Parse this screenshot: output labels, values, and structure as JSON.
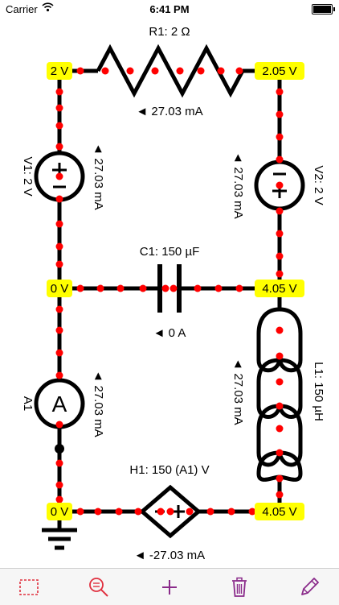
{
  "status_bar": {
    "carrier": "Carrier",
    "time": "6:41 PM"
  },
  "components": {
    "r1": "R1: 2 Ω",
    "v1": "V1: 2 V",
    "v2": "V2: 2 V",
    "c1": "C1: 150 µF",
    "a1": "A1",
    "l1": "L1: 150 µH",
    "h1": "H1: 150 (A1) V"
  },
  "nodes": {
    "top_left": "2 V",
    "top_right": "2.05 V",
    "mid_left": "0 V",
    "mid_right": "4.05 V",
    "bottom_left": "0 V",
    "bottom_right": "4.05 V"
  },
  "currents": {
    "r1": "◄ 27.03 mA",
    "v1": "◄ 27.03 mA",
    "v2": "◄ 27.03 mA",
    "c1": "◄ 0 A",
    "a1": "◄ 27.03 mA",
    "l1": "◄ 27.03 mA",
    "h1": "◄ -27.03 mA"
  },
  "ammeter_symbol": "A",
  "colors": {
    "wire": "#000000",
    "current_dot": "#ff0000",
    "node_label_bg": "#ffff00",
    "toolbar_icon": "#8a2a8a",
    "tool_select": "#e0303f"
  },
  "toolbar": {
    "select_icon": "select-rectangle-icon",
    "zoom_icon": "zoom-icon",
    "add_icon": "plus-icon",
    "delete_icon": "trash-icon",
    "edit_icon": "pencil-icon"
  }
}
